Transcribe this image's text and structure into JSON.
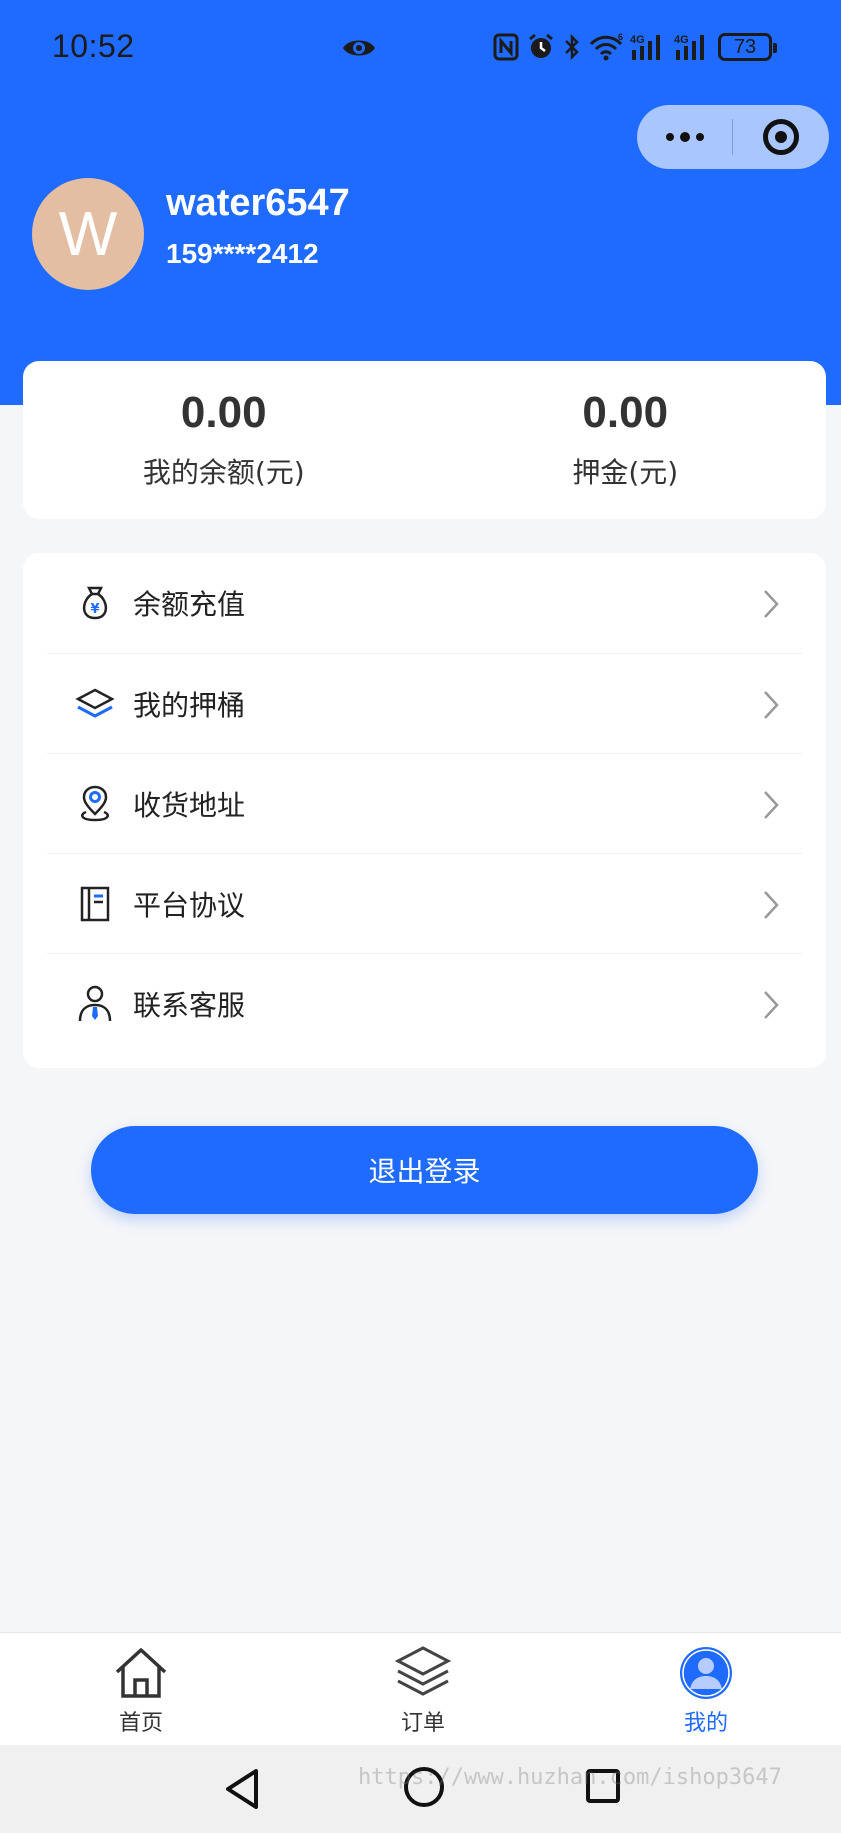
{
  "status_bar": {
    "time": "10:52",
    "net_left": "4G",
    "net_right": "4G",
    "wifi_sup": "6",
    "battery": "73"
  },
  "profile": {
    "avatar_letter": "W",
    "username": "water6547",
    "phone": "159****2412"
  },
  "balance": {
    "my_balance_value": "0.00",
    "my_balance_label": "我的余额(元)",
    "deposit_value": "0.00",
    "deposit_label": "押金(元)"
  },
  "menu": {
    "items": [
      {
        "label": "余额充值",
        "icon": "money-bag-icon"
      },
      {
        "label": "我的押桶",
        "icon": "layers-icon"
      },
      {
        "label": "收货地址",
        "icon": "location-pin-icon"
      },
      {
        "label": "平台协议",
        "icon": "book-icon"
      },
      {
        "label": "联系客服",
        "icon": "customer-service-icon"
      }
    ]
  },
  "logout_label": "退出登录",
  "tabbar": {
    "tabs": [
      {
        "label": "首页",
        "icon": "home-icon",
        "active": false
      },
      {
        "label": "订单",
        "icon": "layers-icon",
        "active": false
      },
      {
        "label": "我的",
        "icon": "user-icon",
        "active": true
      }
    ]
  },
  "watermark": "https://www.huzhan.com/ishop3647",
  "colors": {
    "primary": "#1f6bff",
    "avatar_bg": "#e3bea3",
    "page_bg": "#f5f6f8"
  }
}
